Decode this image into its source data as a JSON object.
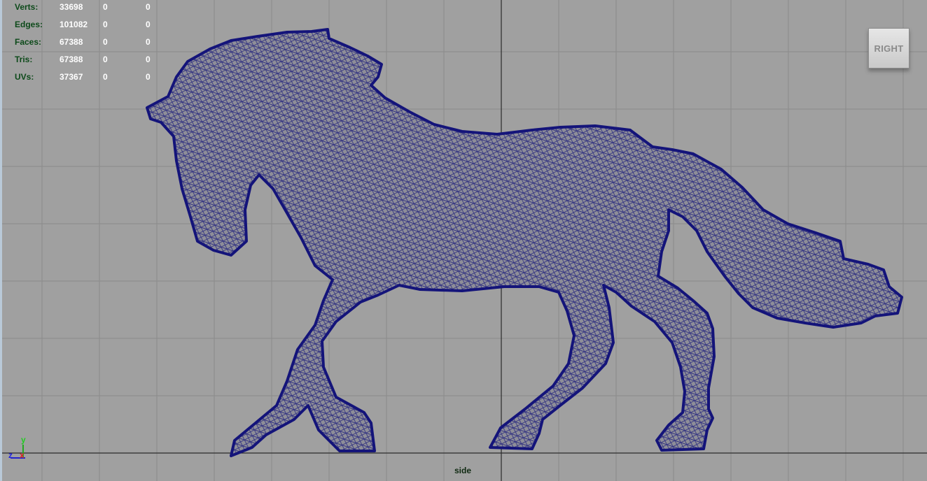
{
  "hud": {
    "rows": [
      {
        "label": "Verts:",
        "total": "33698",
        "selected": "0",
        "components": "0"
      },
      {
        "label": "Edges:",
        "total": "101082",
        "selected": "0",
        "components": "0"
      },
      {
        "label": "Faces:",
        "total": "67388",
        "selected": "0",
        "components": "0"
      },
      {
        "label": "Tris:",
        "total": "67388",
        "selected": "0",
        "components": "0"
      },
      {
        "label": "UVs:",
        "total": "37367",
        "selected": "0",
        "components": "0"
      }
    ]
  },
  "view_cube": {
    "label": "RIGHT"
  },
  "camera": {
    "name": "side"
  },
  "axis": {
    "y": "y",
    "z": "z",
    "x": "x"
  },
  "colors": {
    "background": "#a0a0a0",
    "grid": "#8a8a8a",
    "origin_axis": "#2a2a2a",
    "mesh_wire": "#14147a",
    "mesh_fill": "#8e8e98",
    "hud_label": "#0d4a1a",
    "hud_value": "#ffffff"
  },
  "icons": {
    "view_cube": "view-cube-icon",
    "axis": "axis-indicator-icon"
  }
}
